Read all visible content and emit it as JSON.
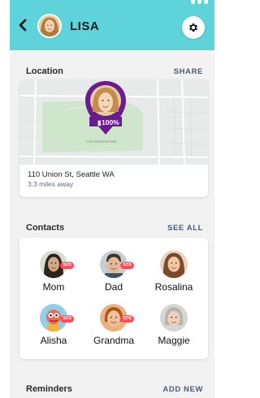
{
  "header": {
    "name": "LISA",
    "back_icon": "chevron-left-icon",
    "settings_icon": "gear-icon",
    "accent": "#5fd3da"
  },
  "location": {
    "title": "Location",
    "action": "SHARE",
    "battery": "100%",
    "map_label": "Cal Anderson Park",
    "address": "110 Union St, Seattle WA",
    "distance": "3.3 miles away",
    "pin_color": "#6a1c8f"
  },
  "contacts": {
    "title": "Contacts",
    "action": "SEE ALL",
    "sos_label": "SOS",
    "items": [
      {
        "name": "Mom",
        "sos": true
      },
      {
        "name": "Dad",
        "sos": true
      },
      {
        "name": "Rosalina",
        "sos": false
      },
      {
        "name": "Alisha",
        "sos": true
      },
      {
        "name": "Grandma",
        "sos": true
      },
      {
        "name": "Maggie",
        "sos": false
      }
    ]
  },
  "reminders": {
    "title": "Reminders",
    "action": "ADD NEW"
  }
}
